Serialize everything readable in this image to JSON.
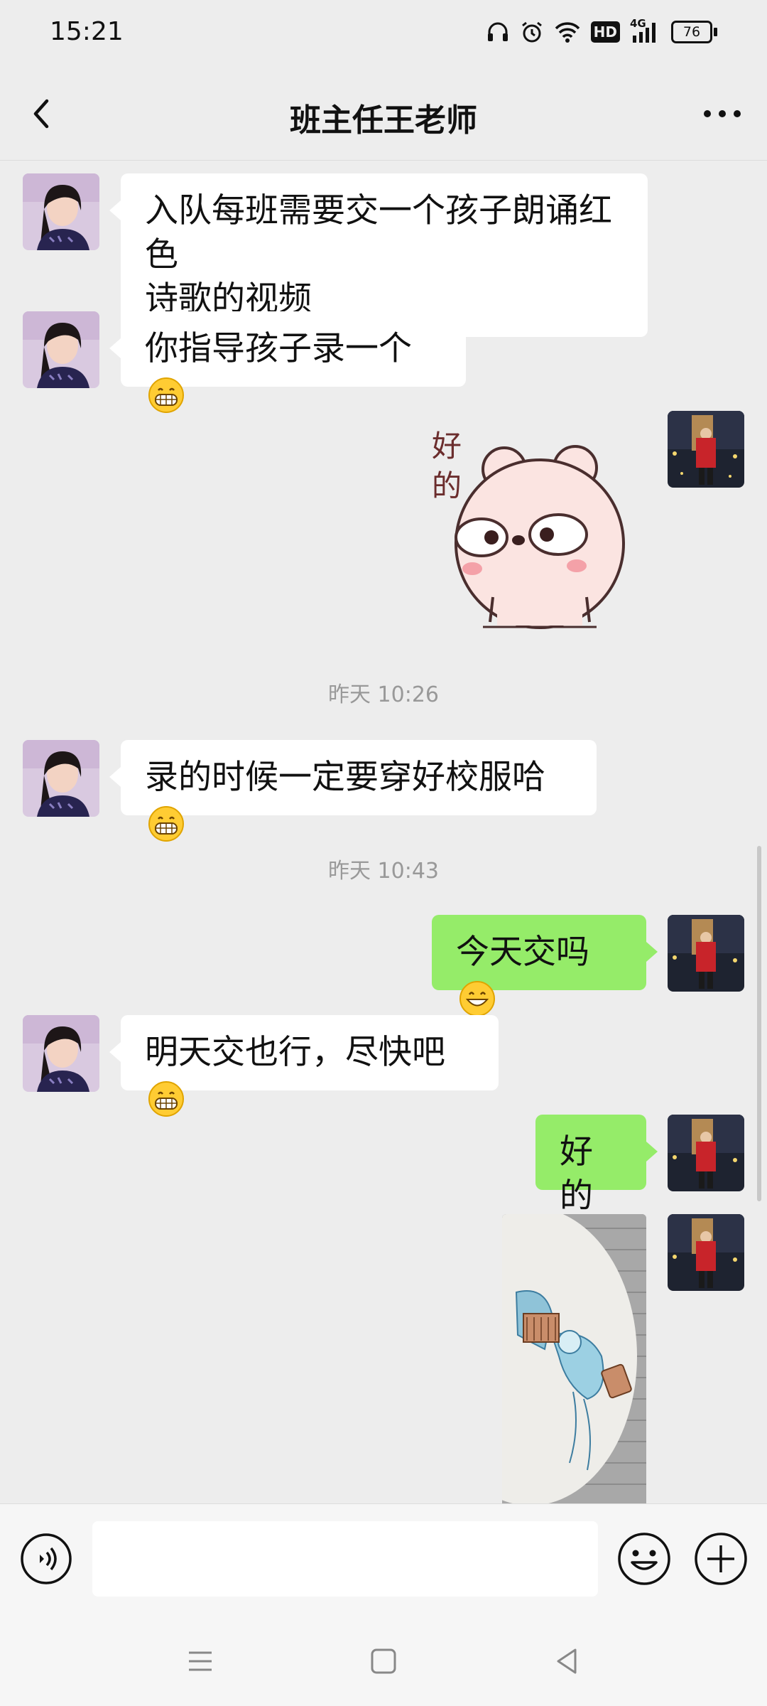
{
  "status_bar": {
    "time": "15:21",
    "network_label": "4G",
    "hd_label": "HD",
    "battery_level": "76"
  },
  "header": {
    "title": "班主任王老师"
  },
  "messages": [
    {
      "from": "teacher",
      "text": "入队每班需要交一个孩子朗诵红色\n诗歌的视频"
    },
    {
      "from": "teacher",
      "text": "你指导孩子录一个",
      "emoji": "grin"
    },
    {
      "from": "me",
      "sticker_text": "好\n的",
      "sticker": "pink-bear"
    },
    {
      "timestamp": "昨天 10:26"
    },
    {
      "from": "teacher",
      "text": "录的时候一定要穿好校服哈",
      "emoji": "grin"
    },
    {
      "timestamp": "昨天 10:43"
    },
    {
      "from": "me",
      "text": "今天交吗",
      "emoji": "smile"
    },
    {
      "from": "teacher",
      "text": "明天交也行，尽快吧",
      "emoji": "grin"
    },
    {
      "from": "me",
      "text": "好的"
    },
    {
      "from": "me",
      "image": "drawing-photo"
    }
  ],
  "colors": {
    "background": "#ededed",
    "my_bubble": "#95ec69",
    "other_bubble": "#ffffff",
    "timestamp": "#999999"
  },
  "icons": {
    "back": "chevron-left-icon",
    "more": "more-dots-icon",
    "voice": "voice-icon",
    "emoji": "emoji-icon",
    "plus": "plus-icon"
  }
}
